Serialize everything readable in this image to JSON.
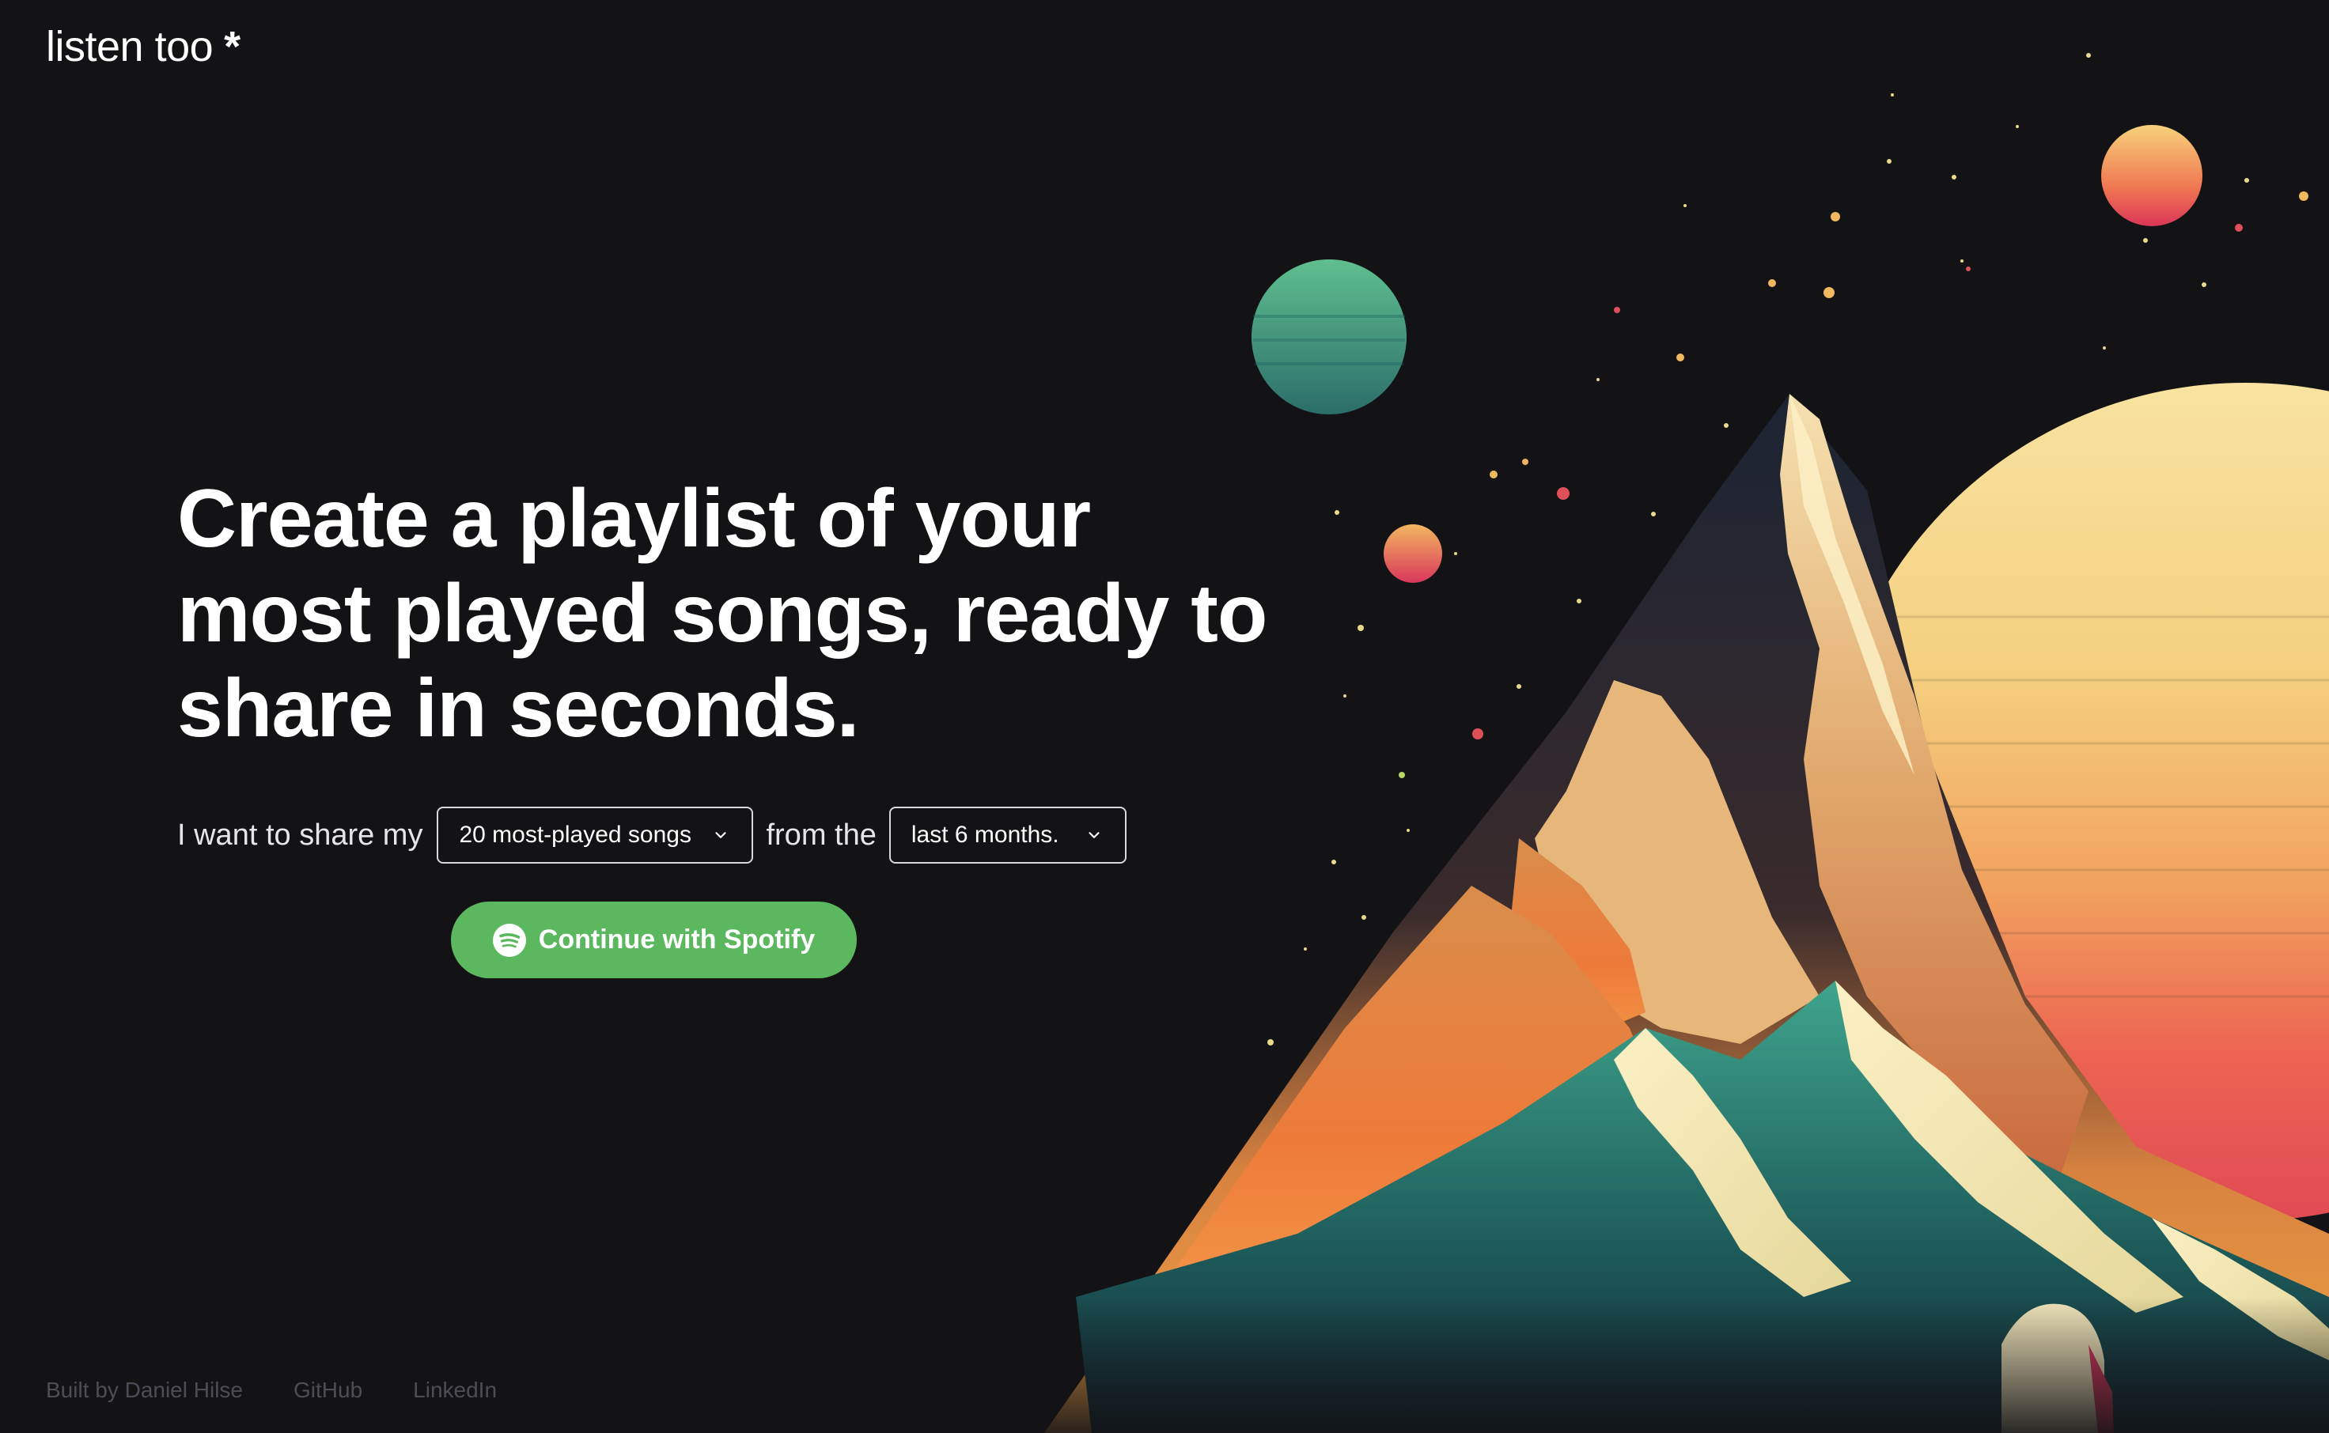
{
  "app": {
    "logo_text": "listen too",
    "logo_mark": "*"
  },
  "hero": {
    "title": "Create a playlist of your most played songs, ready to share in seconds."
  },
  "share_form": {
    "prefix": "I want to share my",
    "songs_select": {
      "value": "20 most-played songs",
      "icon": "chevron-down-icon"
    },
    "middle": "from the",
    "period_select": {
      "value": "last 6 months.",
      "icon": "chevron-down-icon"
    }
  },
  "cta": {
    "label": "Continue with Spotify",
    "icon": "spotify-icon",
    "color": "#5cb85f"
  },
  "footer": {
    "credit": "Built by Daniel Hilse",
    "github": "GitHub",
    "linkedin": "LinkedIn"
  },
  "colors": {
    "background": "#131316",
    "accent": "#5cb85f",
    "footer_text": "#4d4d55"
  }
}
